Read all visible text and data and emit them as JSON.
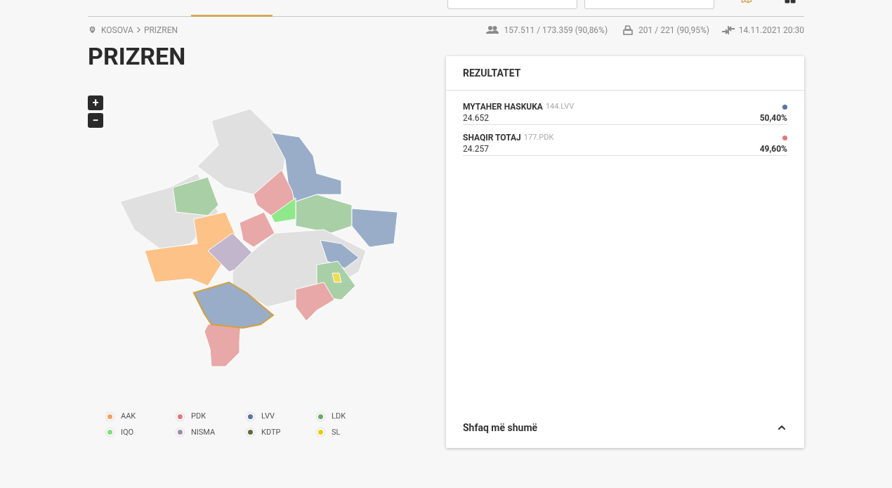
{
  "breadcrumb": [
    "KOSOVA",
    "PRIZREN"
  ],
  "stats": {
    "voters": "157.511 / 173.359 (90,86%)",
    "stations": "201 / 221 (90,95%)",
    "updated": "14.11.2021 20:30"
  },
  "title": "PRIZREN",
  "zoom_controls": [
    "+",
    "−"
  ],
  "legend": [
    {
      "label": "AAK",
      "color": "#f4a259"
    },
    {
      "label": "PDK",
      "color": "#e07a7a"
    },
    {
      "label": "LVV",
      "color": "#5a72a8"
    },
    {
      "label": "LDK",
      "color": "#6aaa6a"
    },
    {
      "label": "IQO",
      "color": "#7ee07e"
    },
    {
      "label": "NISMA",
      "color": "#9e8aa8"
    },
    {
      "label": "KDTP",
      "color": "#5e6b3a"
    },
    {
      "label": "SL",
      "color": "#e8cc00"
    }
  ],
  "results": {
    "title": "REZULTATET",
    "candidates": [
      {
        "name": "MYTAHER HASKUKA",
        "list": "144.LVV",
        "votes": "24.652",
        "percent": "50,40%",
        "color": "#5a72a8"
      },
      {
        "name": "SHAQIR TOTAJ",
        "list": "177.PDK",
        "votes": "24.257",
        "percent": "49,60%",
        "color": "#e07a7a"
      }
    ],
    "more": "Shfaq më shumë"
  }
}
